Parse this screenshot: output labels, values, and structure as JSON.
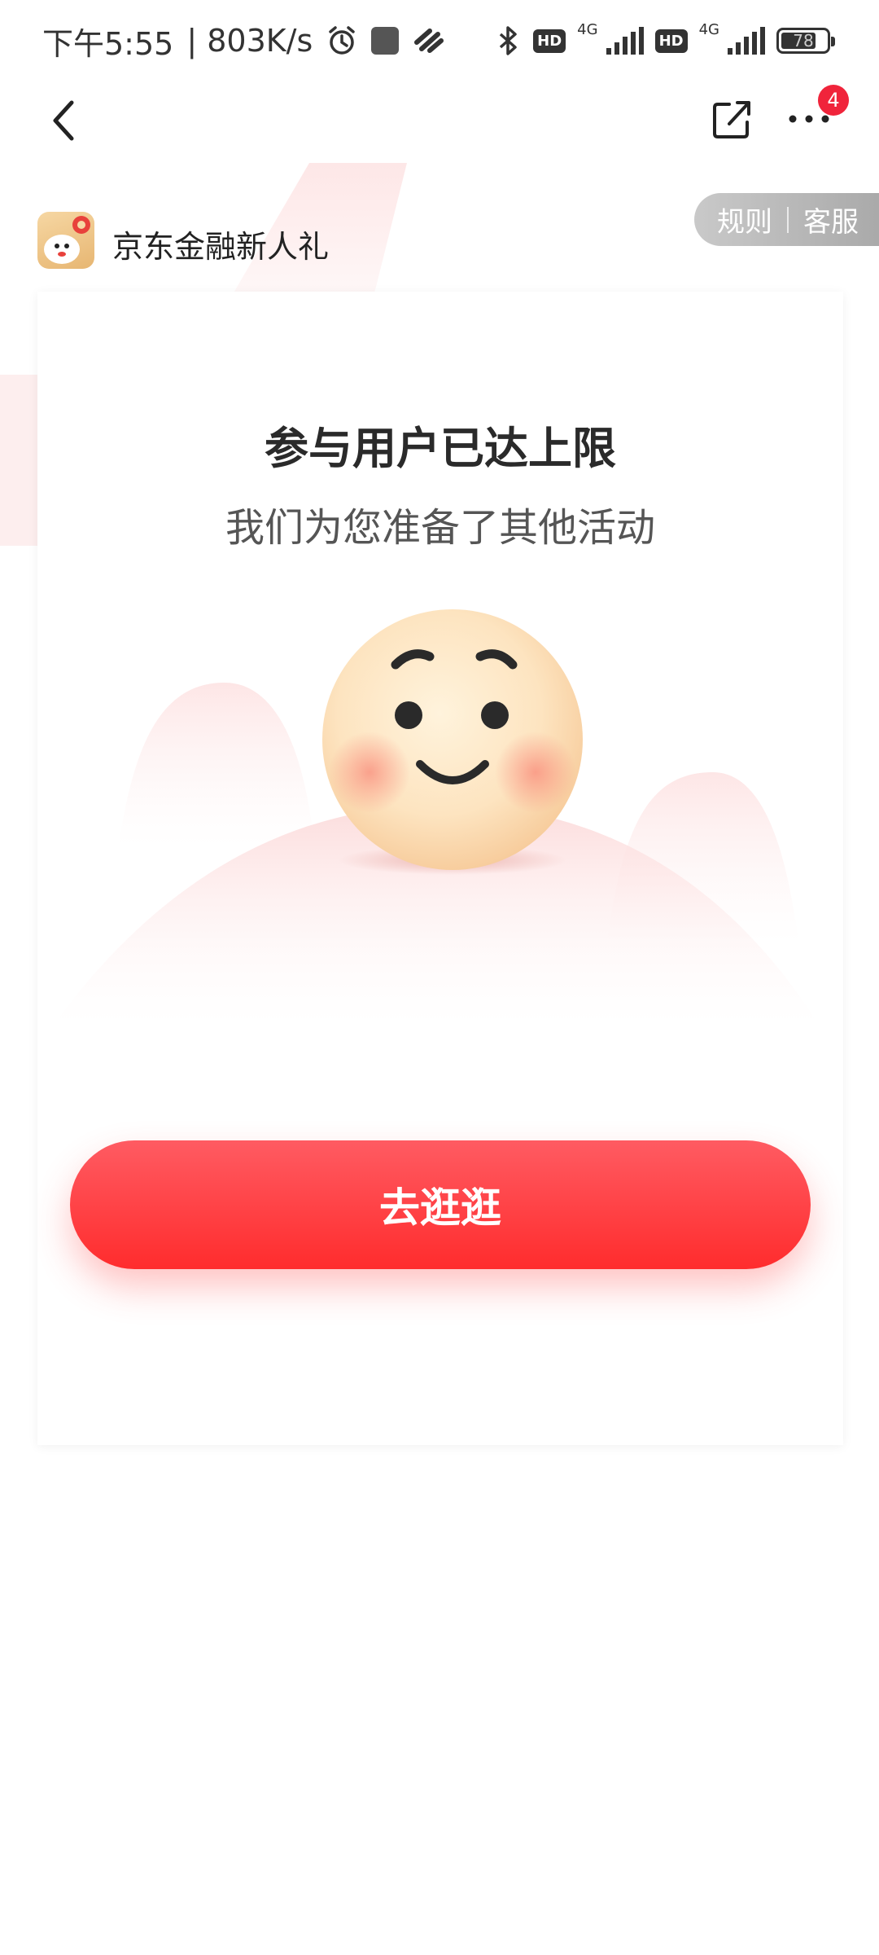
{
  "status_bar": {
    "time": "下午5:55",
    "speed": "| 803K/s",
    "hd1": "HD",
    "net1": "4G",
    "hd2": "HD",
    "net2": "4G",
    "battery": "78",
    "battery_level": 0.78
  },
  "nav": {
    "badge_count": "4"
  },
  "header": {
    "activity_title": "京东金融新人礼",
    "rules_label": "规则",
    "service_label": "客服"
  },
  "card": {
    "title": "参与用户已达上限",
    "subtitle": "我们为您准备了其他活动",
    "cta_label": "去逛逛"
  },
  "colors": {
    "accent": "#ff3b3f",
    "badge": "#f0243b"
  }
}
